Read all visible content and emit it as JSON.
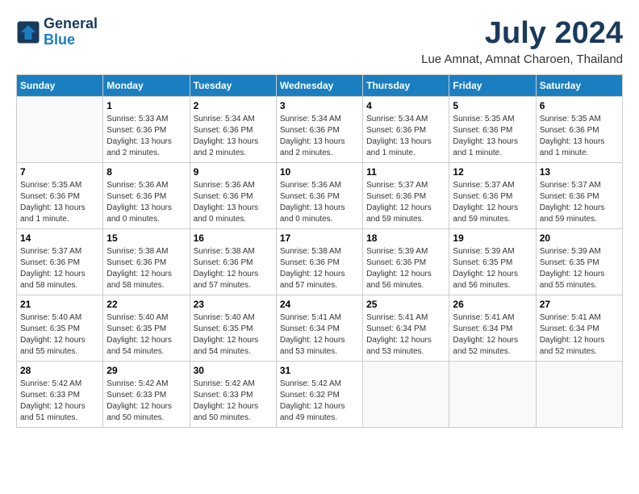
{
  "header": {
    "logo_line1": "General",
    "logo_line2": "Blue",
    "month_year": "July 2024",
    "location": "Lue Amnat, Amnat Charoen, Thailand"
  },
  "days_of_week": [
    "Sunday",
    "Monday",
    "Tuesday",
    "Wednesday",
    "Thursday",
    "Friday",
    "Saturday"
  ],
  "weeks": [
    [
      {
        "day": "",
        "empty": true
      },
      {
        "day": "1",
        "sunrise": "5:33 AM",
        "sunset": "6:36 PM",
        "daylight": "13 hours and 2 minutes."
      },
      {
        "day": "2",
        "sunrise": "5:34 AM",
        "sunset": "6:36 PM",
        "daylight": "13 hours and 2 minutes."
      },
      {
        "day": "3",
        "sunrise": "5:34 AM",
        "sunset": "6:36 PM",
        "daylight": "13 hours and 2 minutes."
      },
      {
        "day": "4",
        "sunrise": "5:34 AM",
        "sunset": "6:36 PM",
        "daylight": "13 hours and 1 minute."
      },
      {
        "day": "5",
        "sunrise": "5:35 AM",
        "sunset": "6:36 PM",
        "daylight": "13 hours and 1 minute."
      },
      {
        "day": "6",
        "sunrise": "5:35 AM",
        "sunset": "6:36 PM",
        "daylight": "13 hours and 1 minute."
      }
    ],
    [
      {
        "day": "7",
        "sunrise": "5:35 AM",
        "sunset": "6:36 PM",
        "daylight": "13 hours and 1 minute."
      },
      {
        "day": "8",
        "sunrise": "5:36 AM",
        "sunset": "6:36 PM",
        "daylight": "13 hours and 0 minutes."
      },
      {
        "day": "9",
        "sunrise": "5:36 AM",
        "sunset": "6:36 PM",
        "daylight": "13 hours and 0 minutes."
      },
      {
        "day": "10",
        "sunrise": "5:36 AM",
        "sunset": "6:36 PM",
        "daylight": "13 hours and 0 minutes."
      },
      {
        "day": "11",
        "sunrise": "5:37 AM",
        "sunset": "6:36 PM",
        "daylight": "12 hours and 59 minutes."
      },
      {
        "day": "12",
        "sunrise": "5:37 AM",
        "sunset": "6:36 PM",
        "daylight": "12 hours and 59 minutes."
      },
      {
        "day": "13",
        "sunrise": "5:37 AM",
        "sunset": "6:36 PM",
        "daylight": "12 hours and 59 minutes."
      }
    ],
    [
      {
        "day": "14",
        "sunrise": "5:37 AM",
        "sunset": "6:36 PM",
        "daylight": "12 hours and 58 minutes."
      },
      {
        "day": "15",
        "sunrise": "5:38 AM",
        "sunset": "6:36 PM",
        "daylight": "12 hours and 58 minutes."
      },
      {
        "day": "16",
        "sunrise": "5:38 AM",
        "sunset": "6:36 PM",
        "daylight": "12 hours and 57 minutes."
      },
      {
        "day": "17",
        "sunrise": "5:38 AM",
        "sunset": "6:36 PM",
        "daylight": "12 hours and 57 minutes."
      },
      {
        "day": "18",
        "sunrise": "5:39 AM",
        "sunset": "6:36 PM",
        "daylight": "12 hours and 56 minutes."
      },
      {
        "day": "19",
        "sunrise": "5:39 AM",
        "sunset": "6:35 PM",
        "daylight": "12 hours and 56 minutes."
      },
      {
        "day": "20",
        "sunrise": "5:39 AM",
        "sunset": "6:35 PM",
        "daylight": "12 hours and 55 minutes."
      }
    ],
    [
      {
        "day": "21",
        "sunrise": "5:40 AM",
        "sunset": "6:35 PM",
        "daylight": "12 hours and 55 minutes."
      },
      {
        "day": "22",
        "sunrise": "5:40 AM",
        "sunset": "6:35 PM",
        "daylight": "12 hours and 54 minutes."
      },
      {
        "day": "23",
        "sunrise": "5:40 AM",
        "sunset": "6:35 PM",
        "daylight": "12 hours and 54 minutes."
      },
      {
        "day": "24",
        "sunrise": "5:41 AM",
        "sunset": "6:34 PM",
        "daylight": "12 hours and 53 minutes."
      },
      {
        "day": "25",
        "sunrise": "5:41 AM",
        "sunset": "6:34 PM",
        "daylight": "12 hours and 53 minutes."
      },
      {
        "day": "26",
        "sunrise": "5:41 AM",
        "sunset": "6:34 PM",
        "daylight": "12 hours and 52 minutes."
      },
      {
        "day": "27",
        "sunrise": "5:41 AM",
        "sunset": "6:34 PM",
        "daylight": "12 hours and 52 minutes."
      }
    ],
    [
      {
        "day": "28",
        "sunrise": "5:42 AM",
        "sunset": "6:33 PM",
        "daylight": "12 hours and 51 minutes."
      },
      {
        "day": "29",
        "sunrise": "5:42 AM",
        "sunset": "6:33 PM",
        "daylight": "12 hours and 50 minutes."
      },
      {
        "day": "30",
        "sunrise": "5:42 AM",
        "sunset": "6:33 PM",
        "daylight": "12 hours and 50 minutes."
      },
      {
        "day": "31",
        "sunrise": "5:42 AM",
        "sunset": "6:32 PM",
        "daylight": "12 hours and 49 minutes."
      },
      {
        "day": "",
        "empty": true
      },
      {
        "day": "",
        "empty": true
      },
      {
        "day": "",
        "empty": true
      }
    ]
  ]
}
